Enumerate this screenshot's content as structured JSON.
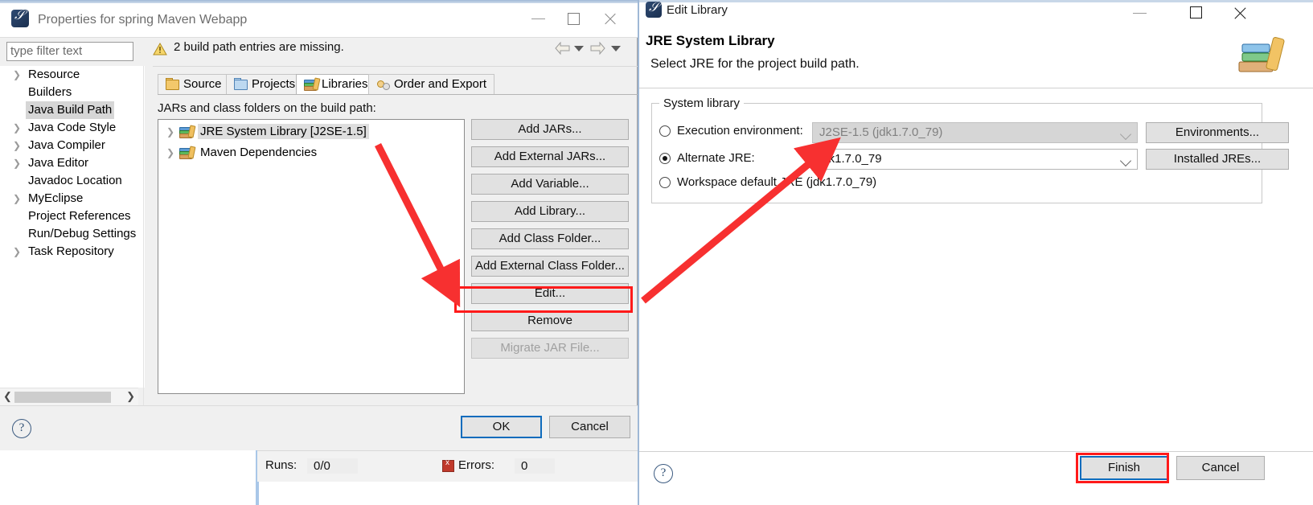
{
  "properties_dialog": {
    "title": "Properties for spring Maven Webapp",
    "app_icon": "eclipse-icon",
    "window_buttons": {
      "minimize": "–",
      "maximize": "□",
      "close": "✕"
    },
    "filter": {
      "placeholder": "type filter text",
      "value": "type filter text"
    },
    "tree_items": [
      {
        "label": "Resource",
        "expandable": true,
        "selected": false
      },
      {
        "label": "Builders",
        "expandable": false,
        "selected": false
      },
      {
        "label": "Java Build Path",
        "expandable": false,
        "selected": true
      },
      {
        "label": "Java Code Style",
        "expandable": true,
        "selected": false
      },
      {
        "label": "Java Compiler",
        "expandable": true,
        "selected": false
      },
      {
        "label": "Java Editor",
        "expandable": true,
        "selected": false
      },
      {
        "label": "Javadoc Location",
        "expandable": false,
        "selected": false
      },
      {
        "label": "MyEclipse",
        "expandable": true,
        "selected": false
      },
      {
        "label": "Project References",
        "expandable": false,
        "selected": false
      },
      {
        "label": "Run/Debug Settings",
        "expandable": false,
        "selected": false
      },
      {
        "label": "Task Repository",
        "expandable": true,
        "selected": false
      }
    ],
    "warning": {
      "text": "2 build path entries are missing.",
      "icon": "warning-icon"
    },
    "nav": {
      "back": "back-arrow-icon",
      "back_menu": "chevron-down-icon",
      "forward": "forward-arrow-icon",
      "forward_menu": "chevron-down-icon"
    },
    "tabs": [
      {
        "label": "Source",
        "icon": "source-folder-icon",
        "active": false
      },
      {
        "label": "Projects",
        "icon": "projects-folder-icon",
        "active": false
      },
      {
        "label": "Libraries",
        "icon": "books-icon",
        "active": true
      },
      {
        "label": "Order and Export",
        "icon": "order-export-icon",
        "active": false
      }
    ],
    "list_label": "JARs and class folders on the build path:",
    "list_items": [
      {
        "label": "JRE System Library [J2SE-1.5]",
        "icon": "books-icon",
        "expandable": true,
        "selected": true
      },
      {
        "label": "Maven Dependencies",
        "icon": "books-icon",
        "expandable": true,
        "selected": false
      }
    ],
    "buttons": [
      {
        "label": "Add JARs...",
        "disabled": false,
        "highlighted": false
      },
      {
        "label": "Add External JARs...",
        "disabled": false,
        "highlighted": false
      },
      {
        "label": "Add Variable...",
        "disabled": false,
        "highlighted": false
      },
      {
        "label": "Add Library...",
        "disabled": false,
        "highlighted": false
      },
      {
        "label": "Add Class Folder...",
        "disabled": false,
        "highlighted": false
      },
      {
        "label": "Add External Class Folder...",
        "disabled": false,
        "highlighted": false
      },
      {
        "label": "Edit...",
        "disabled": false,
        "highlighted": true
      },
      {
        "label": "Remove",
        "disabled": false,
        "highlighted": false
      },
      {
        "label": "Migrate JAR File...",
        "disabled": true,
        "highlighted": false
      }
    ],
    "footer": {
      "help": "?",
      "ok": "OK",
      "cancel": "Cancel"
    }
  },
  "edit_library_dialog": {
    "title": "Edit Library",
    "app_icon": "eclipse-icon",
    "window_buttons": {
      "minimize": "–",
      "maximize": "□",
      "close": "✕"
    },
    "heading": "JRE System Library",
    "subtitle": "Select JRE for the project build path.",
    "banner_icon": "books-stack-icon",
    "group_label": "System library",
    "options": [
      {
        "label": "Execution environment:",
        "selected": false,
        "combo_value": "J2SE-1.5 (jdk1.7.0_79)",
        "combo_disabled": true,
        "side_button": "Environments..."
      },
      {
        "label": "Alternate JRE:",
        "selected": true,
        "combo_value": "jdk1.7.0_79",
        "combo_disabled": false,
        "side_button": "Installed JREs..."
      },
      {
        "label": "Workspace default JRE (jdk1.7.0_79)",
        "selected": false,
        "combo_value": null,
        "combo_disabled": false,
        "side_button": null
      }
    ],
    "footer": {
      "help": "?",
      "finish": "Finish",
      "cancel": "Cancel"
    }
  },
  "background": {
    "status_runs_label": "Runs:",
    "status_runs_value": "0/0",
    "status_errors_label": "Errors:",
    "status_errors_value": "0",
    "errors_icon": "error-icon"
  },
  "annotations": {
    "highlight_color": "#ff1a1a",
    "arrow_from_tree_to_edit": "red-arrow-icon",
    "arrow_from_edit_to_alternate_jre": "red-arrow-icon",
    "box_edit_button": "red-highlight-box",
    "box_finish_button": "red-highlight-box"
  }
}
